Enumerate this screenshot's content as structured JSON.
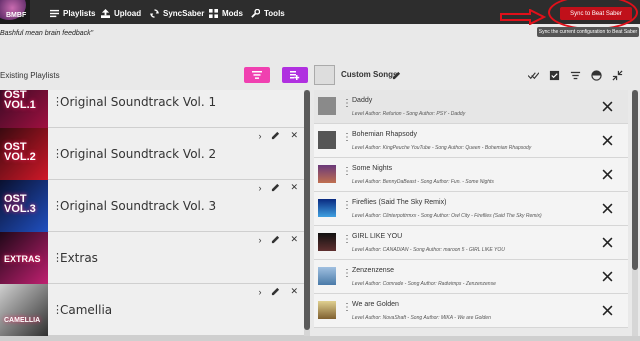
{
  "app": {
    "logo_text": "BMBF",
    "quote": "Bashful mean brain feedback\""
  },
  "nav": [
    {
      "label": "Playlists",
      "icon": "list-icon"
    },
    {
      "label": "Upload",
      "icon": "upload-icon"
    },
    {
      "label": "SyncSaber",
      "icon": "sync-icon"
    },
    {
      "label": "Mods",
      "icon": "grid-icon"
    },
    {
      "label": "Tools",
      "icon": "wrench-icon"
    }
  ],
  "sync": {
    "button_label": "Sync to Beat Saber",
    "tooltip": "Sync the current configuration to Beat Saber",
    "accent": "#c0101a"
  },
  "playlists": {
    "title": "Existing Playlists",
    "items": [
      {
        "name": "Original Soundtrack Vol. 1",
        "cover_text": "OST VOL.1",
        "cover_color": "#6a1030"
      },
      {
        "name": "Original Soundtrack Vol. 2",
        "cover_text": "OST VOL.2",
        "cover_color": "#8a1020"
      },
      {
        "name": "Original Soundtrack Vol. 3",
        "cover_text": "OST VOL.3",
        "cover_color": "#14204a"
      },
      {
        "name": "Extras",
        "cover_text": "EXTRAS",
        "cover_color": "#301030"
      },
      {
        "name": "Camellia",
        "cover_text": "CAMELLIA",
        "cover_color": "#2a2a2a"
      }
    ]
  },
  "custom": {
    "title": "Custom Songs",
    "songs": [
      {
        "title": "Daddy",
        "meta": "Level Author: Refurion - Song Author: PSY - Daddy",
        "thumb": "#7a7a7a"
      },
      {
        "title": "Bohemian Rhapsody",
        "meta": "Level Author: KingPeuche YouTube - Song Author: Queen - Bohemian Rhapsody",
        "thumb": "#555555"
      },
      {
        "title": "Some Nights",
        "meta": "Level Author: BennyDaBeast - Song Author: Fun. - Some Nights",
        "thumb": "#6a3a7a"
      },
      {
        "title": "Fireflies (Said The Sky Remix)",
        "meta": "Level Author: Clinterpottrmxx - Song Author: Owl City - Fireflies (Said The Sky Remix)",
        "thumb": "#1a4aa0"
      },
      {
        "title": "GIRL LIKE YOU",
        "meta": "Level Author: CANADIAN - Song Author: maroon 5 - GIRL LIKE YOU",
        "thumb": "#222222"
      },
      {
        "title": "Zenzenzense",
        "meta": "Level Author: Comrade - Song Author: Radwimps - Zenzenzense",
        "thumb": "#4a7aa8"
      },
      {
        "title": "We are Golden",
        "meta": "Level Author: NovaShaft - Song Author: MIKA - We are Golden",
        "thumb": "#b0a060"
      }
    ]
  }
}
